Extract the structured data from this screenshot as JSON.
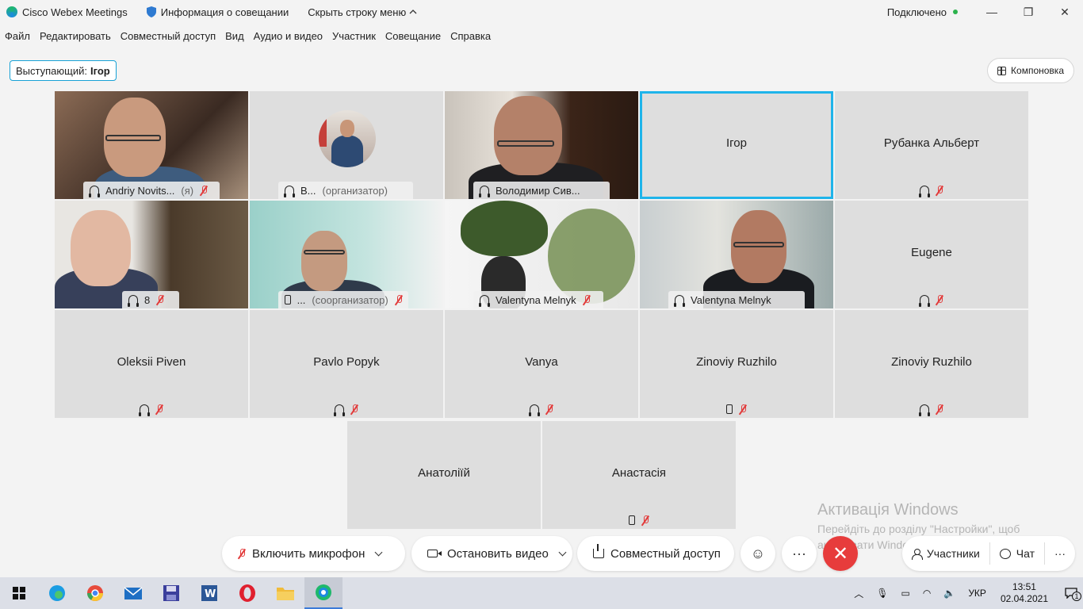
{
  "window": {
    "app_title": "Cisco Webex Meetings",
    "meeting_info": "Информация о совещании",
    "hide_menu": "Скрыть строку меню",
    "status": "Подключено",
    "colors": {
      "accent": "#1fb4ea",
      "connected": "#2bb24c",
      "end_call": "#e73c3c",
      "muted": "#e23b3b"
    }
  },
  "menu": [
    "Файл",
    "Редактировать",
    "Совместный доступ",
    "Вид",
    "Аудио и видео",
    "Участник",
    "Совещание",
    "Справка"
  ],
  "speaker": {
    "label": "Выступающий:",
    "name": "Ігор"
  },
  "layout_button": "Компоновка",
  "video_tiles": [
    {
      "name": "Andriy Novits...",
      "role": "(я)"
    },
    {
      "name": "В...",
      "role": "(организатор)"
    },
    {
      "name": "Володимир Сив..."
    },
    {
      "name": "8"
    },
    {
      "name": "...",
      "role": "(соорганизатор)"
    },
    {
      "name": "Valentyna Melnyk"
    },
    {
      "name": "Valentyna Melnyk"
    }
  ],
  "name_tiles": [
    {
      "name": "Ігор"
    },
    {
      "name": "Рубанка Альберт"
    },
    {
      "name": "Eugene"
    },
    {
      "name": "Oleksii Piven"
    },
    {
      "name": "Pavlo Popyk"
    },
    {
      "name": "Vanya"
    },
    {
      "name": "Zinoviy Ruzhilo"
    },
    {
      "name": "Zinoviy Ruzhilo"
    },
    {
      "name": "Анатоліїй"
    },
    {
      "name": "Анастасія"
    }
  ],
  "watermark": {
    "title": "Активація Windows",
    "subtitle": "Перейдіть до розділу \"Настройки\", щоб активувати Windows."
  },
  "controls": {
    "mic": "Включить микрофон",
    "video": "Остановить видео",
    "share": "Совместный доступ",
    "participants": "Участники",
    "chat": "Чат"
  },
  "taskbar": {
    "lang": "УКР",
    "time": "13:51",
    "date": "02.04.2021",
    "notifications": "1"
  }
}
